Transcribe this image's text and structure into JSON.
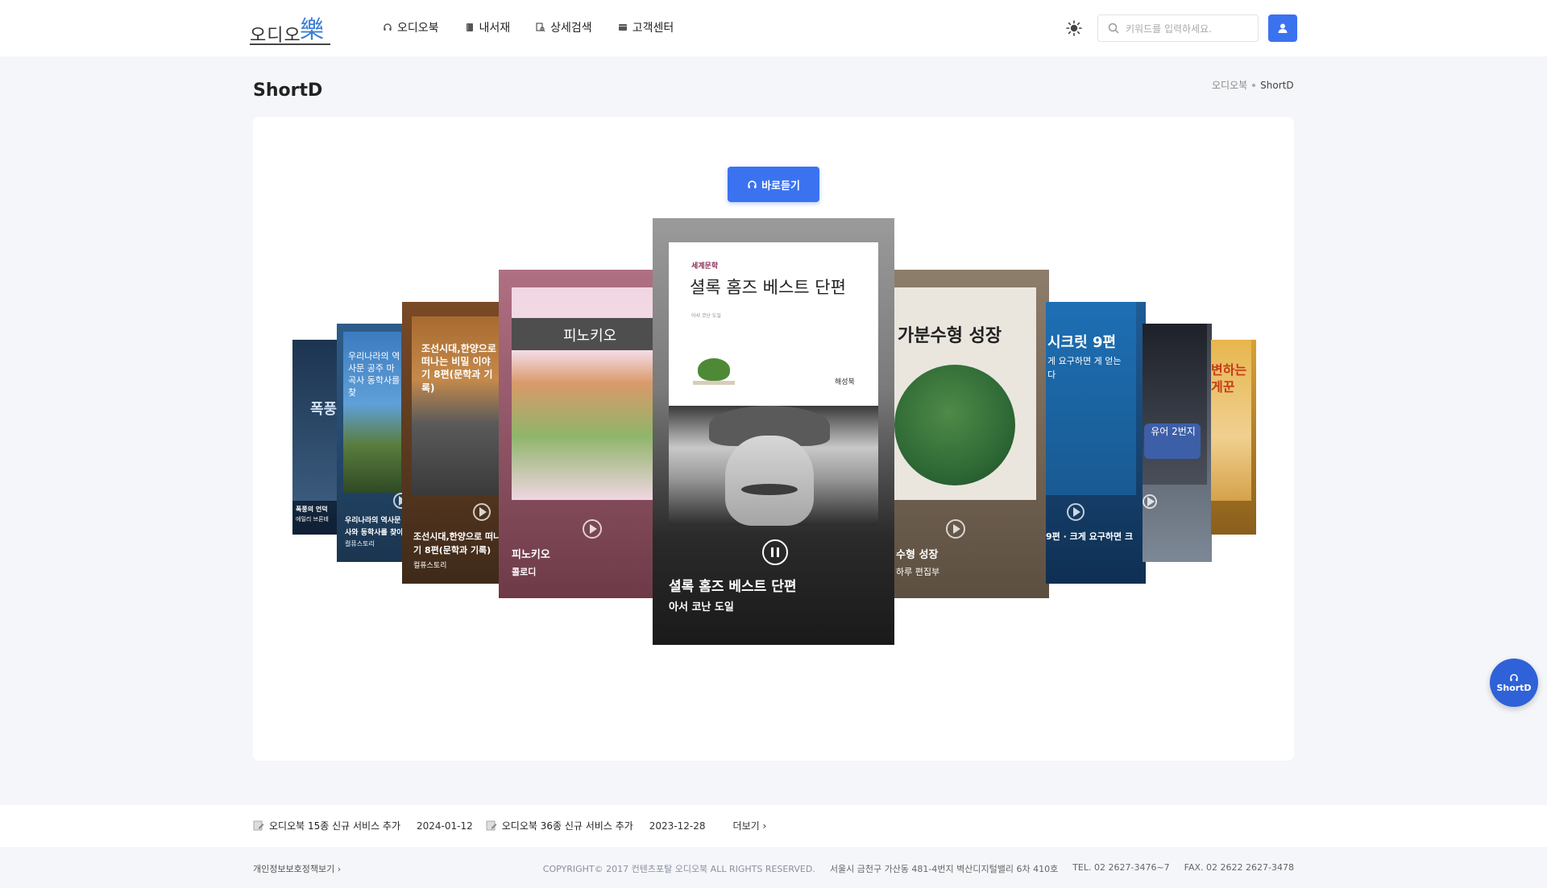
{
  "header": {
    "logo_text": "오디오",
    "logo_mark": "樂",
    "nav": [
      {
        "label": "오디오북",
        "icon": "headphones-icon"
      },
      {
        "label": "내서재",
        "icon": "book-icon"
      },
      {
        "label": "상세검색",
        "icon": "search-doc-icon"
      },
      {
        "label": "고객센터",
        "icon": "help-desk-icon"
      }
    ],
    "search_placeholder": "키워드를 입력하세요.",
    "theme_icon": "sun-icon",
    "user_icon": "user-icon"
  },
  "page": {
    "title": "ShortD",
    "breadcrumb": [
      "오디오북",
      "ShortD"
    ]
  },
  "player": {
    "listen_label": "바로듣기",
    "center": {
      "cover_category": "세계문학",
      "cover_title": "셜록 홈즈 베스트 단편",
      "cover_subtitle": "아서 코난 도일",
      "cover_publisher": "해성북",
      "title": "셜록 홈즈 베스트 단편",
      "author": "아서 코난 도일",
      "state": "playing"
    },
    "slides_left": [
      {
        "cover_text": "피노키오",
        "title": "피노키오",
        "author": "콜로디"
      },
      {
        "cover_text": "조선시대,한양으로 떠나는 비밀 이야기 8편(문학과 기록)",
        "title": "조선시대,한양으로 떠나",
        "title2": "기 8편(문학과 기록)",
        "author": "컬퓨스토리"
      },
      {
        "cover_text": "우리나라의 역사문 공주 마곡사 동학사를 찾",
        "title": "우리나라의 역사문",
        "title2": "사와 동학사를 찾아",
        "author": "컬퓨스토리"
      },
      {
        "cover_text": "폭풍",
        "title": "폭풍의 언덕",
        "author": "에밀리 브론테"
      }
    ],
    "slides_right": [
      {
        "cover_text": "가분수형 성장",
        "title": "수형 성장",
        "author": "하루 편집부"
      },
      {
        "cover_text": "시크릿 9편",
        "cover_sub": "게 요구하면 게 얻는다",
        "title": "9편 · 크게 요구하면 크"
      },
      {
        "cover_text": "유어 2번지"
      },
      {
        "cover_text": "변하는 게꾼"
      }
    ]
  },
  "floating": {
    "label": "ShortD",
    "icon": "headphones-icon"
  },
  "notices": [
    {
      "text": "오디오북 15종 신규 서비스 추가",
      "date": "2024-01-12"
    },
    {
      "text": "오디오북 36종 신규 서비스 추가",
      "date": "2023-12-28"
    }
  ],
  "more_label": "더보기",
  "footer": {
    "privacy": "개인정보보호정책보기",
    "copyright": "COPYRIGHT© 2017 컨텐츠포탈 오디오북 ALL RIGHTS RESERVED.",
    "address": "서울시 금천구 가산동 481-4번지 벽산디지털밸리 6차 410호",
    "tel": "TEL. 02 2627-3476~7",
    "fax": "FAX. 02 2622 2627-3478"
  }
}
